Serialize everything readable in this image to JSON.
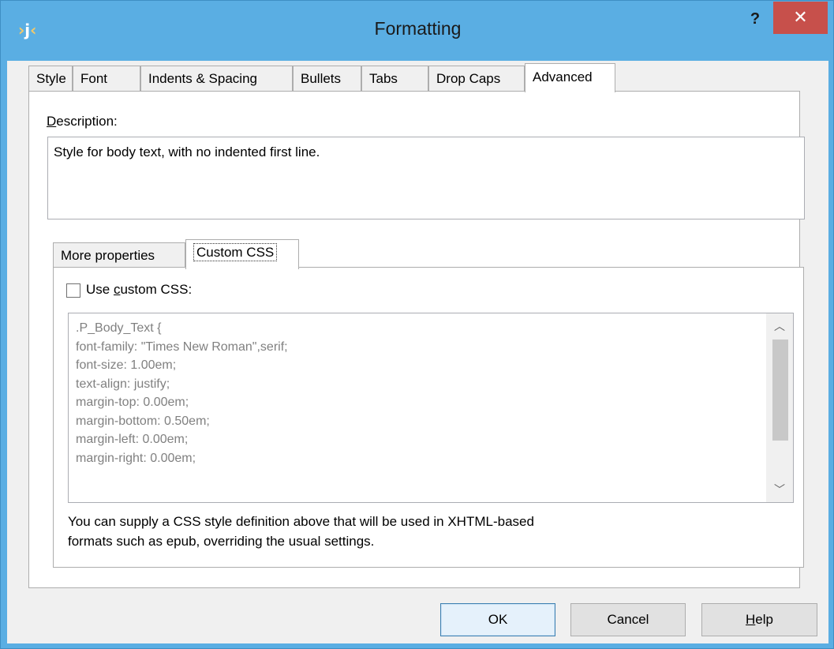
{
  "window": {
    "title": "Formatting",
    "help_glyph": "?",
    "close_glyph": "✕"
  },
  "tabs": [
    "Style",
    "Font",
    "Indents & Spacing",
    "Bullets",
    "Tabs",
    "Drop Caps",
    "Advanced"
  ],
  "active_tab": "Advanced",
  "description": {
    "label_underlined": "D",
    "label_rest": "escription:",
    "value": "Style for body text, with no indented first line."
  },
  "inner_tabs": [
    "More properties",
    "Custom CSS"
  ],
  "active_inner_tab": "Custom CSS",
  "custom_css": {
    "checkbox_label_pre": "Use ",
    "checkbox_label_underlined": "c",
    "checkbox_label_post": "ustom CSS:",
    "checked": false,
    "lines": [
      ".P_Body_Text {",
      "font-family: \"Times New Roman\",serif;",
      "font-size: 1.00em;",
      "text-align: justify;",
      "margin-top: 0.00em;",
      "margin-bottom: 0.50em;",
      "margin-left: 0.00em;",
      "margin-right: 0.00em;"
    ],
    "note_line1": "You can supply a CSS style definition above that will be used in XHTML-based",
    "note_line2": "formats such as epub, overriding the usual settings."
  },
  "buttons": {
    "ok": "OK",
    "cancel": "Cancel",
    "help_underlined": "H",
    "help_rest": "elp"
  }
}
